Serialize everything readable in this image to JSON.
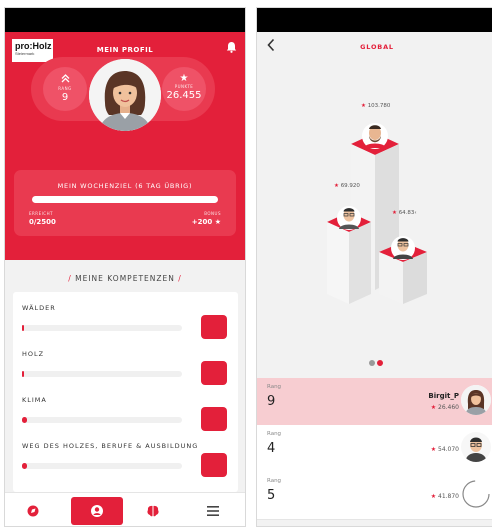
{
  "left_screen": {
    "logo": {
      "name": "pro:Holz",
      "region": "Steiermark"
    },
    "header_title": "MEIN PROFIL",
    "rank": {
      "label": "RANG",
      "value": "9"
    },
    "points": {
      "label": "PUNKTE",
      "value": "26.455"
    },
    "weekly_goal": {
      "title": "MEIN WOCHENZIEL (6 TAG ÜBRIG)",
      "progress_fraction": 0,
      "earned_label": "ERREICHT",
      "earned_value": "0/2500",
      "bonus_label": "BONUS",
      "bonus_value": "+200"
    },
    "competencies_heading": "MEINE KOMPETENZEN",
    "competencies": [
      {
        "label": "WÄLDER",
        "progress_fraction": 0.01
      },
      {
        "label": "HOLZ",
        "progress_fraction": 0.01
      },
      {
        "label": "KLIMA",
        "progress_fraction": 0.03
      },
      {
        "label": "WEG DES HOLZES, BERUFE & AUSBILDUNG",
        "progress_fraction": 0.03
      }
    ],
    "nav": [
      "explore-icon",
      "profile-icon",
      "brain-icon",
      "menu-icon"
    ]
  },
  "right_screen": {
    "title": "GLOBAL",
    "podium": [
      {
        "place": 1,
        "score": "103.780"
      },
      {
        "place": 2,
        "score": "69.920"
      },
      {
        "place": 3,
        "score": "64.83‹"
      }
    ],
    "pager_dots": 2,
    "active_dot": 1,
    "ranking": [
      {
        "label": "Rang",
        "rank": "9",
        "name": "Birgit_P",
        "score": "26.460",
        "highlight": true
      },
      {
        "label": "Rang",
        "rank": "4",
        "name": "",
        "score": "54.070",
        "highlight": false
      },
      {
        "label": "Rang",
        "rank": "5",
        "name": "",
        "score": "41.870",
        "highlight": false
      }
    ]
  },
  "colors": {
    "brand_red": "#e3203a",
    "card_red": "#e93a50",
    "background": "#f2f2f2"
  }
}
